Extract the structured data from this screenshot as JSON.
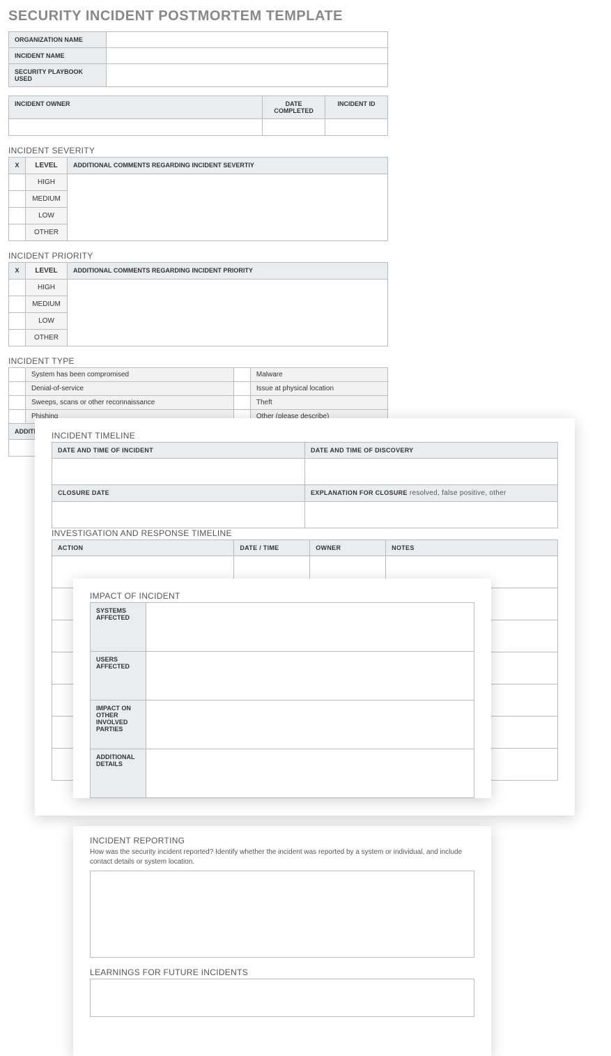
{
  "title": "SECURITY INCIDENT POSTMORTEM TEMPLATE",
  "metaRows": {
    "org": "ORGANIZATION NAME",
    "incident": "INCIDENT NAME",
    "playbook": "SECURITY PLAYBOOK USED"
  },
  "ownerRow": {
    "owner": "INCIDENT OWNER",
    "date": "DATE COMPLETED",
    "id": "INCIDENT ID"
  },
  "severity": {
    "title": "INCIDENT SEVERITY",
    "xcol": "X",
    "levelcol": "LEVEL",
    "commentscol": "ADDITIONAL COMMENTS REGARDING INCIDENT SEVERTIY",
    "levels": [
      "HIGH",
      "MEDIUM",
      "LOW",
      "OTHER"
    ]
  },
  "priority": {
    "title": "INCIDENT PRIORITY",
    "xcol": "X",
    "levelcol": "LEVEL",
    "commentscol": "ADDITIONAL COMMENTS REGARDING INCIDENT PRIORITY",
    "levels": [
      "HIGH",
      "MEDIUM",
      "LOW",
      "OTHER"
    ]
  },
  "type": {
    "title": "INCIDENT TYPE",
    "left": [
      "System has been compromised",
      "Denial-of-service",
      "Sweeps, scans or other reconnaissance",
      "Phishing"
    ],
    "right": [
      "Malware",
      "Issue at physical location",
      "Theft",
      "Other (please describe)"
    ],
    "extra": "ADDITIONAL COMMENTS / \"OTHER\" DESCRIPTION"
  },
  "timeline": {
    "title": "INCIDENT TIMELINE",
    "dt_incident": "DATE AND TIME OF INCIDENT",
    "dt_discovery": "DATE AND TIME OF DISCOVERY",
    "closure": "CLOSURE DATE",
    "explanation_label": "EXPLANATION FOR CLOSURE",
    "explanation_hint": "  resolved, false positive, other"
  },
  "response": {
    "title": "INVESTIGATION AND RESPONSE TIMELINE",
    "action": "ACTION",
    "dt": "DATE / TIME",
    "owner": "OWNER",
    "notes": "NOTES"
  },
  "impact": {
    "title": "IMPACT OF INCIDENT",
    "rows": [
      "SYSTEMS AFFECTED",
      "USERS AFFECTED",
      "IMPACT ON OTHER INVOLVED PARTIES",
      "ADDITIONAL DETAILS"
    ]
  },
  "reporting": {
    "title": "INCIDENT REPORTING",
    "desc": "How was the security incident reported? Identify whether the incident was reported by a system or individual, and include contact details or system location."
  },
  "learnings": {
    "title": "LEARNINGS FOR FUTURE INCIDENTS"
  }
}
